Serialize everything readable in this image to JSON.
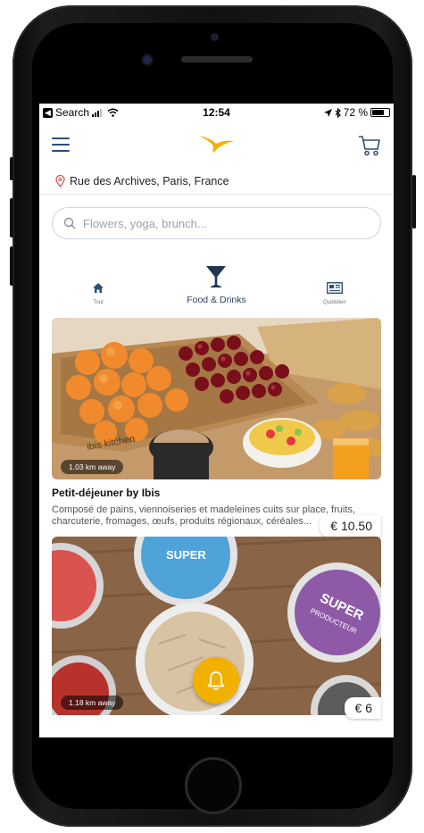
{
  "statusbar": {
    "back_app": "Search",
    "time": "12:54",
    "battery_text": "72 %",
    "battery_level": 0.72
  },
  "location": {
    "text": "Rue des Archives, Paris, France"
  },
  "search": {
    "placeholder": "Flowers, yoga, brunch..."
  },
  "tabs": [
    {
      "label": "Tout",
      "icon": "home-icon",
      "active": false
    },
    {
      "label": "Food & Drinks",
      "icon": "cocktail-glass-icon",
      "active": true
    },
    {
      "label": "Quotidien",
      "icon": "newspaper-icon",
      "active": false
    }
  ],
  "cards": [
    {
      "distance": "1.03 km away",
      "price": "€ 10.50",
      "title": "Petit-déjeuner by Ibis",
      "description": "Composé de pains, viennoiseries et madeleines cuits sur place, fruits, charcuterie, fromages, œufs, produits régionaux, céréales...",
      "image_text": "ibis kitchen"
    },
    {
      "distance": "1.18 km away",
      "price": "€ 6",
      "image_text_1": "SUPER",
      "image_text_2": "PRODUCTEUR"
    }
  ],
  "colors": {
    "accent": "#2b4f7a",
    "logo": "#f2b100",
    "bell": "#f2b100",
    "pin": "#d9534f"
  }
}
